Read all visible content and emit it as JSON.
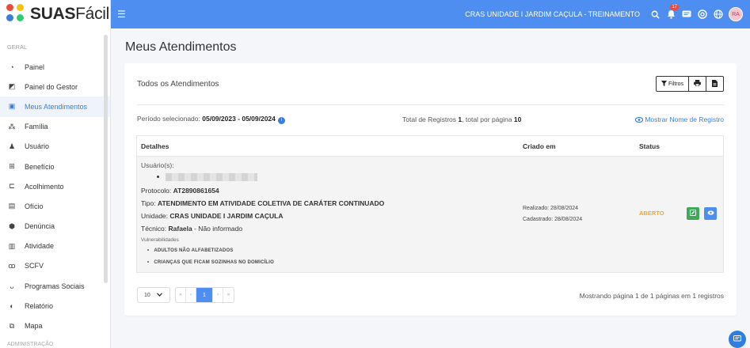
{
  "brand": {
    "bold": "SUAS",
    "light": "Fácil"
  },
  "sidebar": {
    "section_label": "GERAL",
    "section_label_2": "ADMINISTRAÇÃO",
    "items": [
      {
        "label": "Painel",
        "icon": "◔"
      },
      {
        "label": "Painel do Gestor",
        "icon": "◩"
      },
      {
        "label": "Meus Atendimentos",
        "icon": "▣"
      },
      {
        "label": "Família",
        "icon": "⁂"
      },
      {
        "label": "Usuário",
        "icon": "♟"
      },
      {
        "label": "Benefício",
        "icon": "⊞"
      },
      {
        "label": "Acolhimento",
        "icon": "⊏"
      },
      {
        "label": "Ofício",
        "icon": "▤"
      },
      {
        "label": "Denúncia",
        "icon": "⬢"
      },
      {
        "label": "Atividade",
        "icon": "▥"
      },
      {
        "label": "SCFV",
        "icon": "ꝏ"
      },
      {
        "label": "Programas Sociais",
        "icon": "ᴗ"
      },
      {
        "label": "Relatório",
        "icon": "◐"
      },
      {
        "label": "Mapa",
        "icon": "⧉"
      }
    ]
  },
  "topbar": {
    "title": "CRAS UNIDADE I JARDIM CAÇULA  - TREINAMENTO",
    "notifications": "17",
    "avatar": "RA",
    "accent": "#4d8ef0"
  },
  "main": {
    "page_title": "Meus Atendimentos",
    "card_title": "Todos os Atendimentos",
    "filters_label": "Filtros",
    "period_label": "Período selecionado:",
    "period_value": "05/09/2023 - 05/09/2024",
    "total_prefix": "Total de Registros",
    "total_value": "1",
    "total_mid": ", total por página",
    "per_page_value": "10",
    "show_name_link": "Mostrar Nome de Registro",
    "table": {
      "headers": {
        "details": "Detalhes",
        "created": "Criado em",
        "status": "Status"
      },
      "row": {
        "users_label": "Usuário(s):",
        "protocol_label": "Protocolo:",
        "protocol": "AT2890861654",
        "type_label": "Tipo:",
        "type": "ATENDIMENTO EM ATIVIDADE COLETIVA DE CARÁTER CONTINUADO",
        "unit_label": "Unidade:",
        "unit": "CRAS UNIDADE I JARDIM CAÇULA",
        "tech_label": "Técnico:",
        "tech": "Rafaela",
        "tech_suffix": " - Não informado",
        "vuln_label": "Vulnerabilidades",
        "vulnerabilities": [
          "ADULTOS NÃO ALFABETIZADOS",
          "CRIANÇAS QUE FICAM SOZINHAS NO DOMICÍLIO"
        ],
        "realized": "Realizado: 28/08/2024",
        "registered": "Cadastrado: 28/08/2024",
        "status": "ABERTO",
        "status_color": "#f5a623"
      }
    },
    "pager": {
      "page_size": "10",
      "first": "«",
      "prev": "‹",
      "current": "1",
      "next": "›",
      "last": "»",
      "info": "Mostrando página 1 de 1 páginas em 1 registros"
    }
  }
}
